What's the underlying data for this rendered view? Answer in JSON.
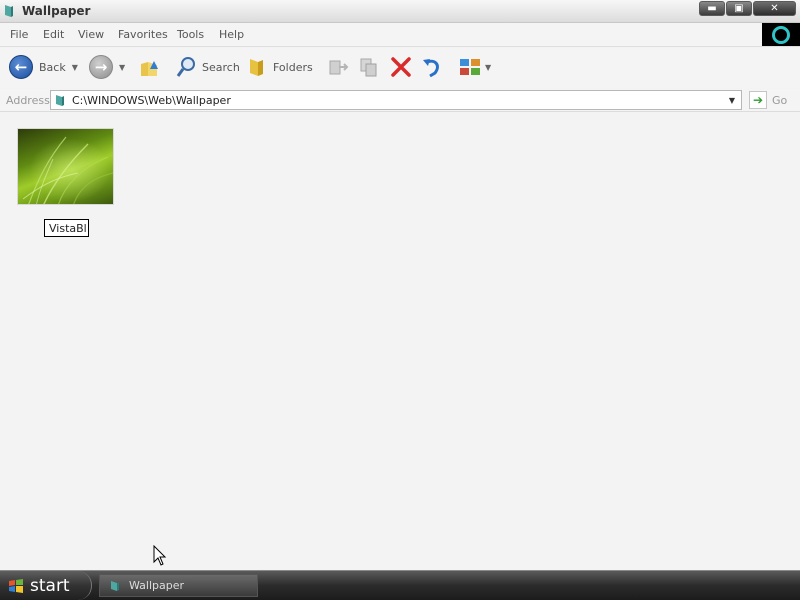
{
  "window": {
    "title": "Wallpaper",
    "controls": {
      "minimize": "▬",
      "restore": "▣",
      "close": "✕"
    }
  },
  "menubar": {
    "items": [
      "File",
      "Edit",
      "View",
      "Favorites",
      "Tools",
      "Help"
    ]
  },
  "toolbar": {
    "back_label": "Back",
    "search_label": "Search",
    "folders_label": "Folders"
  },
  "addressbar": {
    "label": "Address",
    "path": "C:\\WINDOWS\\Web\\Wallpaper",
    "go_label": "Go"
  },
  "content": {
    "items": [
      {
        "rename_value": "VistaBl",
        "icon": "grass-wallpaper-thumbnail"
      }
    ]
  },
  "taskbar": {
    "start_label": "start",
    "tasks": [
      {
        "label": "Wallpaper"
      }
    ]
  },
  "colors": {
    "accent": "#1d4e9e",
    "brand_ring": "#2fc4c8",
    "delete_red": "#d92b2b",
    "go_green": "#2e9b2e"
  }
}
